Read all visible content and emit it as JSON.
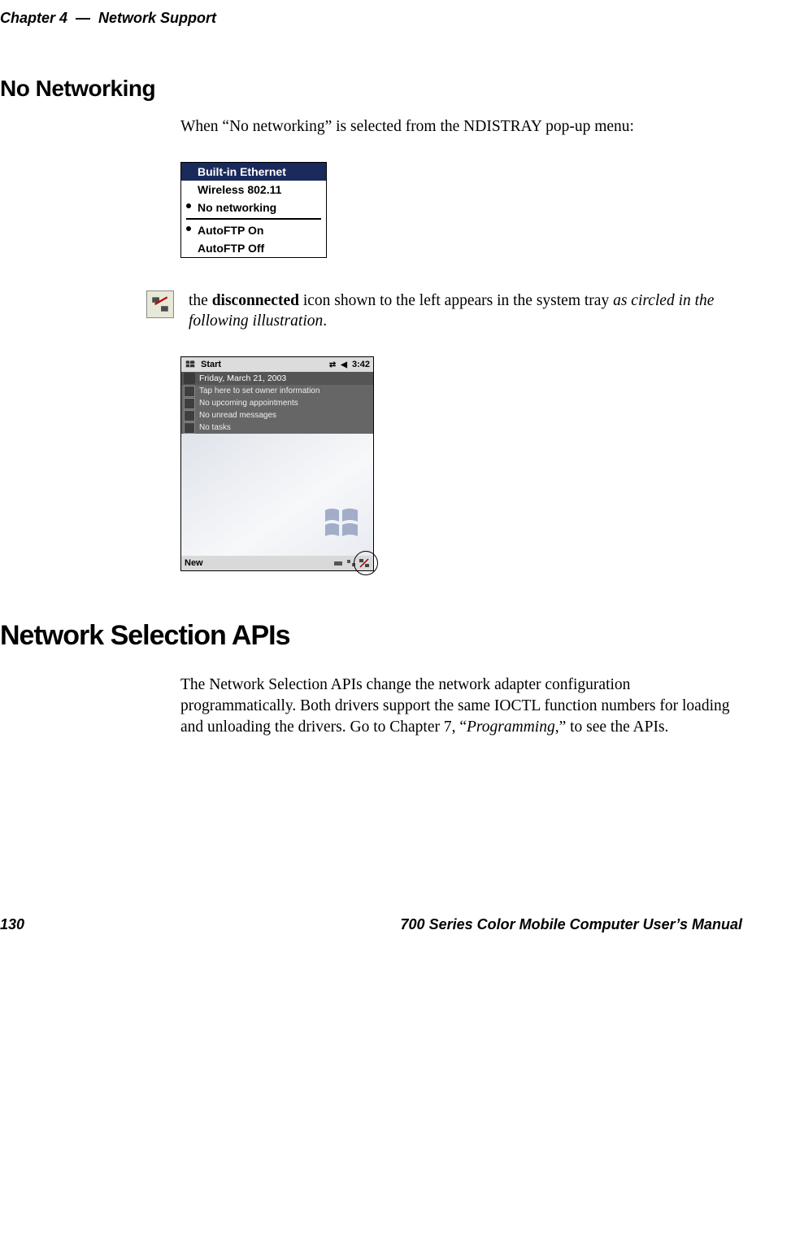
{
  "header": {
    "chapter_label": "Chapter 4",
    "dash": "—",
    "section_title": "Network Support"
  },
  "section1": {
    "heading": "No Networking",
    "intro": "When “No networking” is selected from the NDISTRAY pop-up menu:"
  },
  "popup_menu": {
    "items": [
      {
        "label": "Built-in Ethernet",
        "selected": true,
        "bullet": false
      },
      {
        "label": "Wireless 802.11",
        "selected": false,
        "bullet": false
      },
      {
        "label": "No networking",
        "selected": false,
        "bullet": true
      }
    ],
    "items2": [
      {
        "label": "AutoFTP On",
        "selected": false,
        "bullet": true
      },
      {
        "label": "AutoFTP Off",
        "selected": false,
        "bullet": false
      }
    ]
  },
  "icon_callout": {
    "pre": "the ",
    "bold": "disconnected",
    "mid": " icon shown to the left appears in the system tray ",
    "italic": "as circled in the following illustration",
    "post": "."
  },
  "device_shot": {
    "start_label": "Start",
    "time": "3:42",
    "date": "Friday, March 21, 2003",
    "rows": [
      "Tap here to set owner information",
      "No upcoming appointments",
      "No unread messages",
      "No tasks"
    ],
    "new_label": "New"
  },
  "section2": {
    "heading": "Network Selection APIs",
    "body_pre": "The Network Selection APIs change the network adapter configuration programmatically. Both drivers support the same IOCTL function numbers for loading and unloading the drivers. Go to Chapter 7, “",
    "body_italic": "Programming",
    "body_post": ",” to see the APIs."
  },
  "footer": {
    "page": "130",
    "manual": "700 Series Color Mobile Computer User’s Manual"
  }
}
